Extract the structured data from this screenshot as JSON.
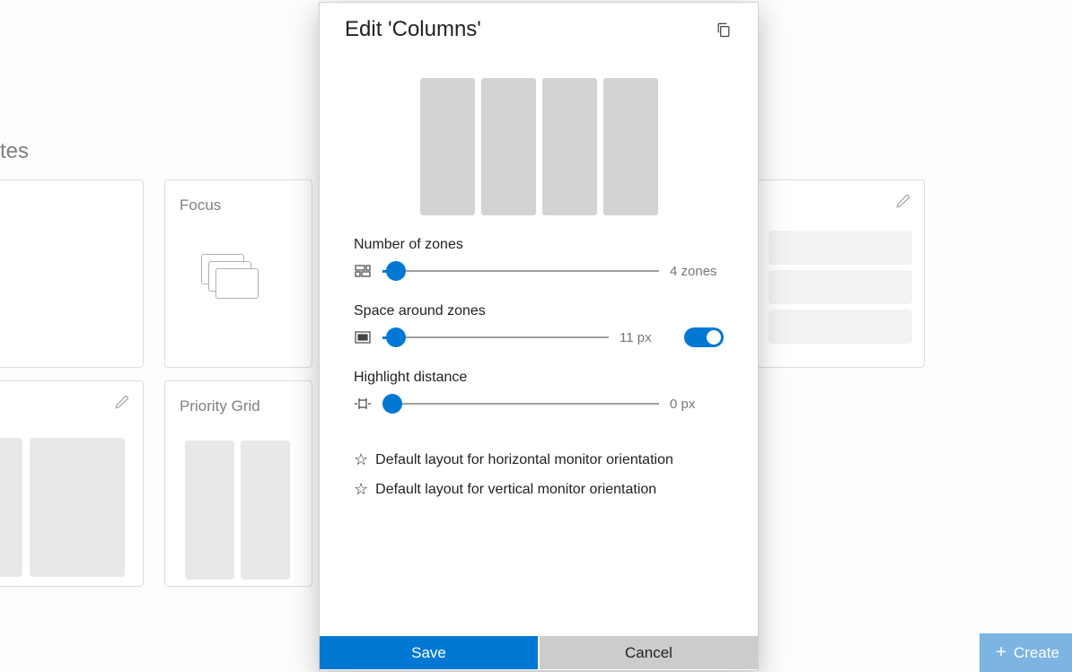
{
  "page": {
    "section_title": "tes"
  },
  "cards": {
    "focus": "Focus",
    "priority_grid": "Priority Grid"
  },
  "dialog": {
    "title": "Edit 'Columns'",
    "zones": {
      "label": "Number of zones",
      "value": 4,
      "unit": "zones"
    },
    "space": {
      "label": "Space around zones",
      "value": 11,
      "unit": "px",
      "toggle": true
    },
    "highlight": {
      "label": "Highlight distance",
      "value": 0,
      "unit": "px"
    },
    "default_horizontal": "Default layout for horizontal monitor orientation",
    "default_vertical": "Default layout for vertical monitor orientation",
    "save": "Save",
    "cancel": "Cancel"
  },
  "create_button": "Create"
}
